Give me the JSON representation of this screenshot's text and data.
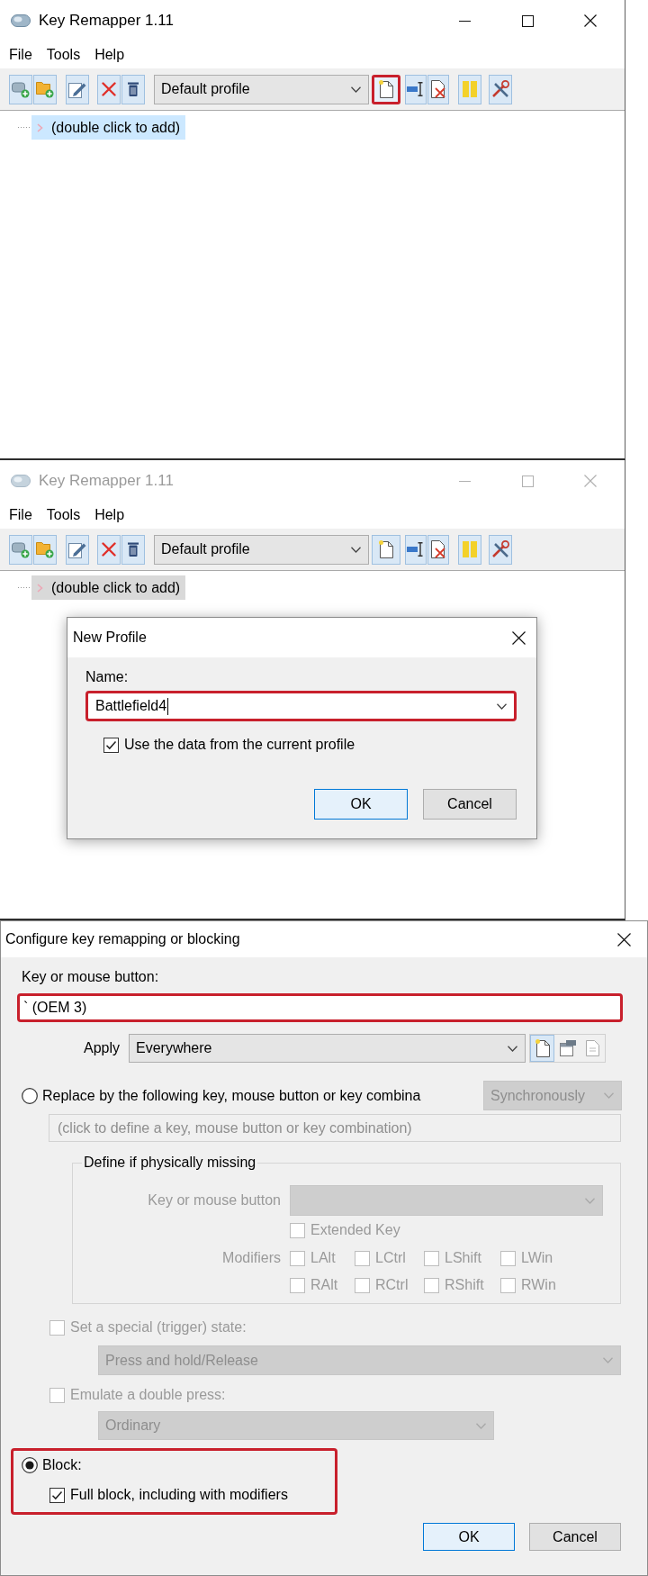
{
  "main_windows": [
    {
      "title": "Key Remapper 1.11",
      "active": true,
      "menu": [
        {
          "label": "File"
        },
        {
          "label": "Tools"
        },
        {
          "label": "Help"
        }
      ],
      "toolbar": {
        "profile": "Default profile",
        "new_profile_highlighted": true
      },
      "tree": [
        {
          "label": "(double click to add)",
          "selected": true
        }
      ]
    },
    {
      "title": "Key Remapper 1.11",
      "active": false,
      "menu": [
        {
          "label": "File"
        },
        {
          "label": "Tools"
        },
        {
          "label": "Help"
        }
      ],
      "toolbar": {
        "profile": "Default profile",
        "new_profile_highlighted": false
      },
      "tree": [
        {
          "label": "(double click to add)",
          "selected": true
        }
      ],
      "dialog": {
        "title": "New Profile",
        "name_label": "Name:",
        "name_value": "Battlefield4",
        "name_highlighted": true,
        "use_current": {
          "label": "Use the data from the current profile",
          "checked": true
        },
        "buttons": [
          {
            "label": "OK",
            "default": true
          },
          {
            "label": "Cancel",
            "default": false
          }
        ]
      }
    }
  ],
  "config_dialog": {
    "title": "Configure key remapping or blocking",
    "key_label": "Key or mouse button:",
    "key_value": "` (OEM 3)",
    "key_highlighted": true,
    "apply_label": "Apply",
    "apply_value": "Everywhere",
    "replace": {
      "label": "Replace by the following key, mouse button or key combina",
      "selected": false,
      "mode": "Synchronously",
      "target": "(click to define a key, mouse button or key combination)",
      "options_disabled": true
    },
    "define_missing": {
      "title": "Define if physically missing",
      "disabled": true,
      "key_label": "Key or mouse button",
      "extended_key": {
        "label": "Extended Key",
        "checked": false
      },
      "modifiers_label": "Modifiers",
      "modifiers": [
        {
          "label": "LAlt",
          "checked": false
        },
        {
          "label": "LCtrl",
          "checked": false
        },
        {
          "label": "LShift",
          "checked": false
        },
        {
          "label": "LWin",
          "checked": false
        },
        {
          "label": "RAlt",
          "checked": false
        },
        {
          "label": "RCtrl",
          "checked": false
        },
        {
          "label": "RShift",
          "checked": false
        },
        {
          "label": "RWin",
          "checked": false
        }
      ]
    },
    "special_state": {
      "label": "Set a special (trigger) state:",
      "checked": false,
      "disabled": true,
      "value": "Press and hold/Release"
    },
    "double_press": {
      "label": "Emulate a double press:",
      "checked": false,
      "disabled": true,
      "value": "Ordinary"
    },
    "block": {
      "label": "Block:",
      "selected": true,
      "highlighted": true,
      "full_block": {
        "label": "Full block, including with modifiers",
        "checked": true
      }
    },
    "buttons": [
      {
        "label": "OK",
        "default": true
      },
      {
        "label": "Cancel",
        "default": false
      }
    ]
  }
}
